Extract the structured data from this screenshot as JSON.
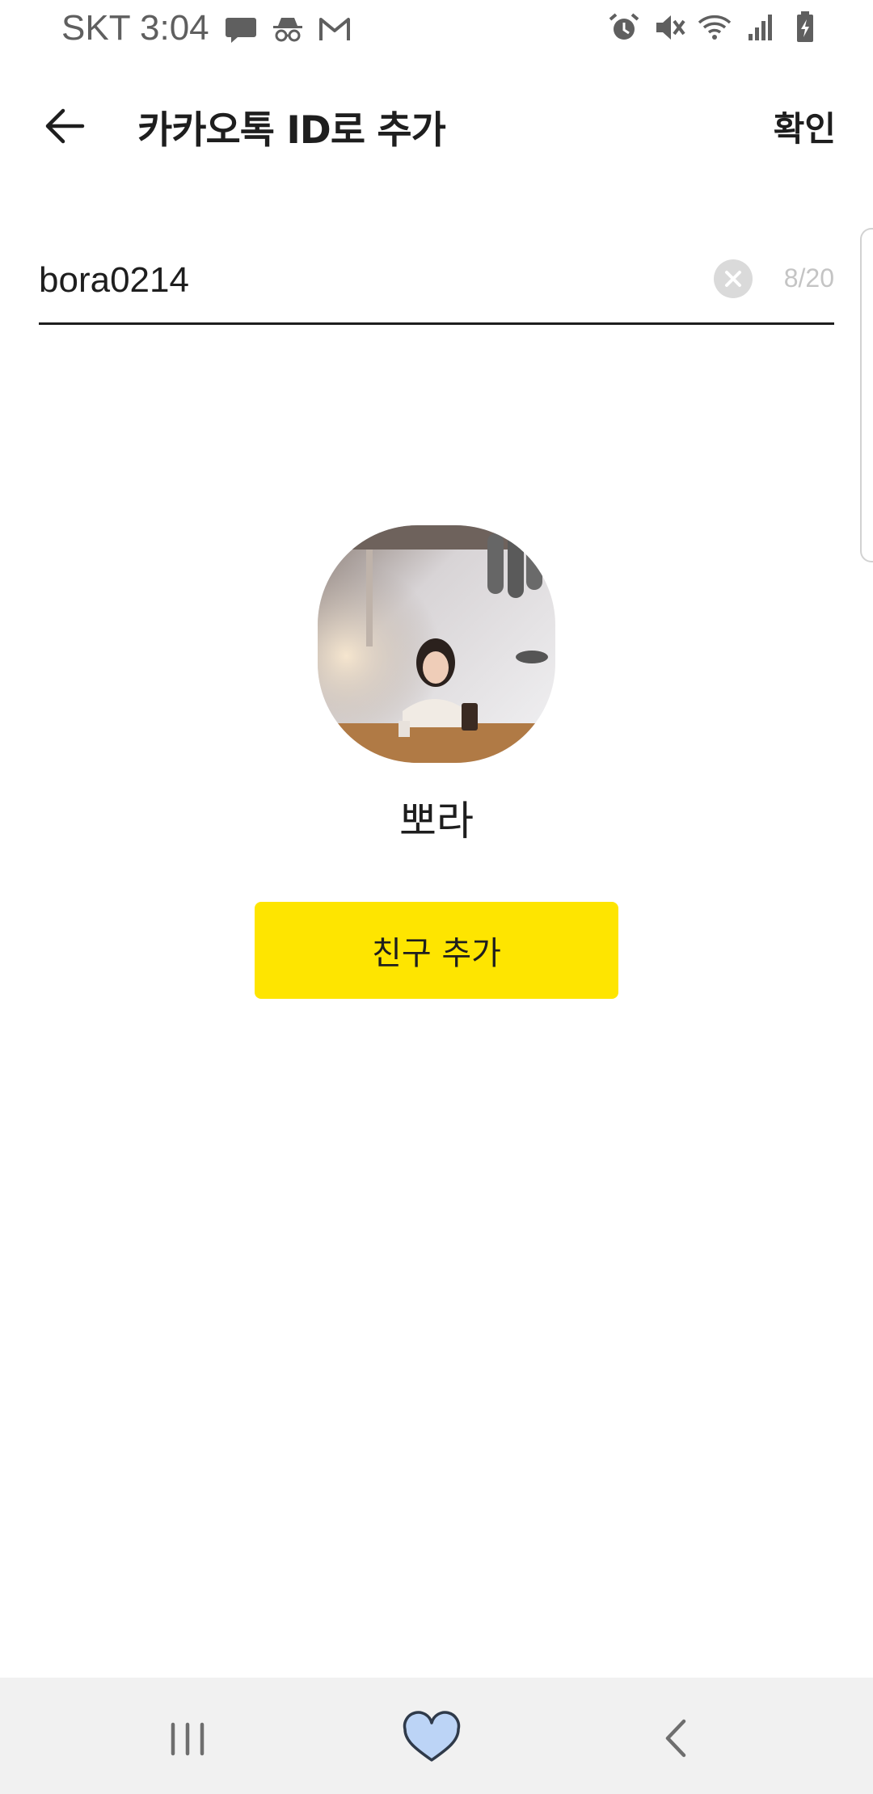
{
  "status_bar": {
    "carrier_time": "SKT 3:04",
    "left_icons": [
      "message-icon",
      "incognito-icon",
      "gmail-icon"
    ],
    "right_icons": [
      "alarm-icon",
      "mute-icon",
      "wifi-icon",
      "signal-icon",
      "battery-charging-icon"
    ]
  },
  "header": {
    "back_icon": "arrow-left-icon",
    "title": "카카오톡 ID로 추가",
    "confirm_label": "확인"
  },
  "search": {
    "value": "bora0214",
    "clear_icon": "clear-circle-icon",
    "char_count": "8/20"
  },
  "profile": {
    "name": "뽀라",
    "photo": "profile-photo"
  },
  "actions": {
    "add_friend_label": "친구 추가"
  },
  "nav_bar": {
    "items": [
      "recent-apps-icon",
      "home-heart-icon",
      "back-icon"
    ]
  },
  "colors": {
    "accent_yellow": "#fee500",
    "text": "#1e1e1e",
    "muted": "#c4c4c4",
    "nav_bg": "#f1f1f1",
    "home_heart": "#bcd4f6"
  }
}
